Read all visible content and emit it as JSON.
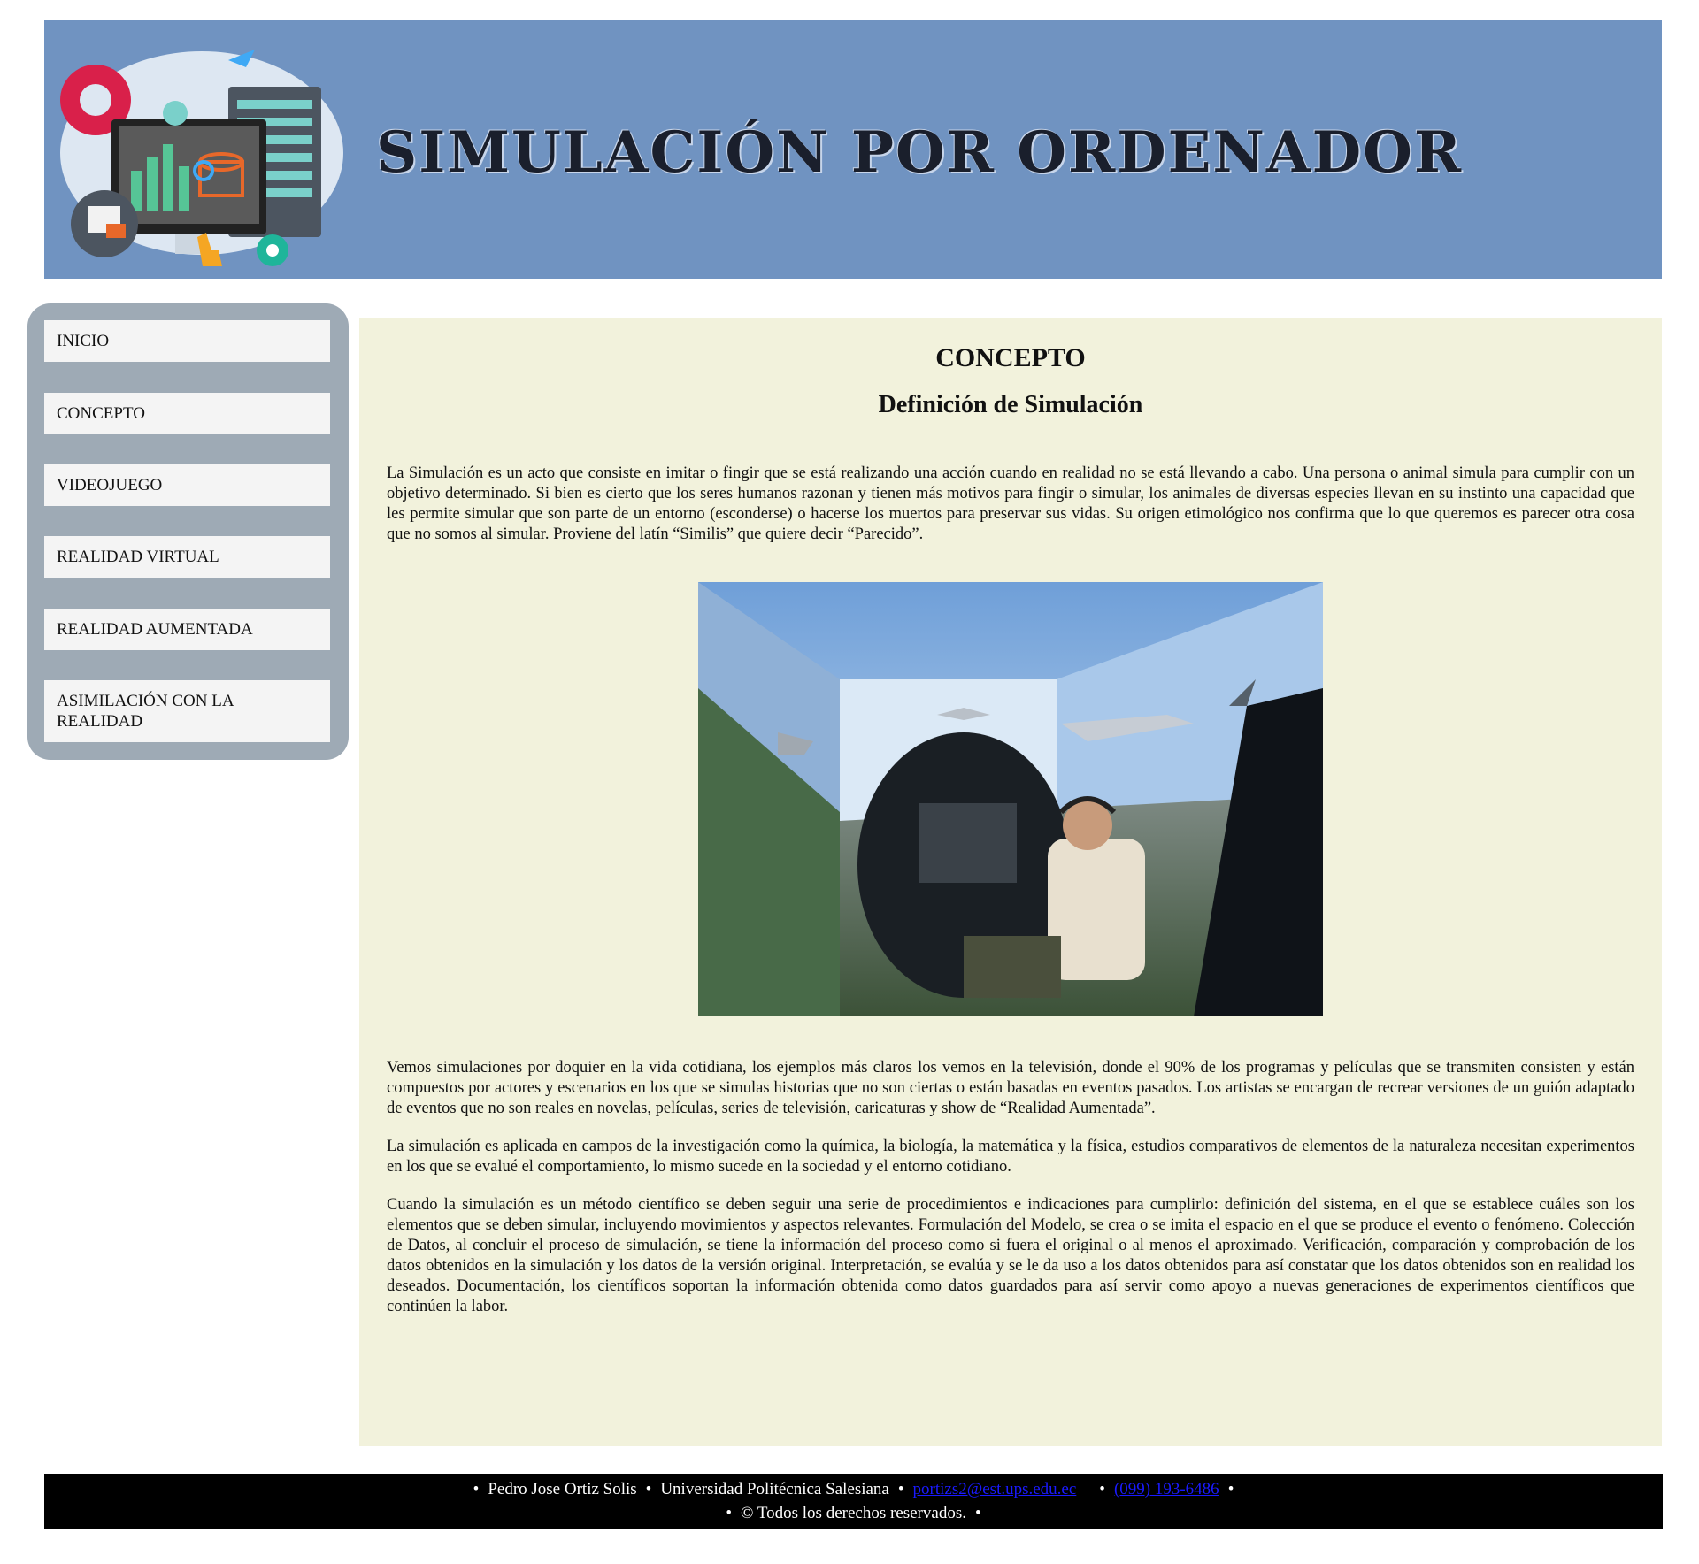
{
  "header": {
    "title": "SIMULACIÓN POR ORDENADOR",
    "logo": "computer-simulation-illustration"
  },
  "nav": {
    "items": [
      {
        "label": "INICIO"
      },
      {
        "label": "CONCEPTO"
      },
      {
        "label": "VIDEOJUEGO"
      },
      {
        "label": "REALIDAD VIRTUAL"
      },
      {
        "label": "REALIDAD AUMENTADA"
      },
      {
        "label": "ASIMILACIÓN CON LA REALIDAD"
      }
    ]
  },
  "main": {
    "heading": "CONCEPTO",
    "subheading": "Definición de Simulación",
    "paragraphs": [
      "La Simulación es un acto que consiste en imitar o fingir que se está realizando una acción cuando en realidad no se está llevando a cabo. Una persona o animal simula para cumplir con un objetivo determinado. Si bien es cierto que los seres humanos razonan y tienen más motivos para fingir o simular, los animales de diversas especies llevan en su instinto una capacidad que les permite simular que son parte de un entorno (esconderse) o hacerse los muertos para preservar sus vidas. Su origen etimológico nos confirma que lo que queremos es parecer otra cosa que no somos al simular. Proviene del latín “Similis” que quiere decir “Parecido”.",
      "Vemos simulaciones por doquier en la vida cotidiana, los ejemplos más claros los vemos en la televisión, donde el 90% de los programas y películas que se transmiten consisten y están compuestos por actores y escenarios en los que se simulas historias que no son ciertas o están basadas en eventos pasados. Los artistas se encargan de recrear versiones de un guión adaptado de eventos que no son reales en novelas, películas, series de televisión, caricaturas y show de “Realidad Aumentada”.",
      "La simulación es aplicada en campos de la investigación como la química, la biología, la matemática y la física, estudios comparativos de elementos de la naturaleza necesitan experimentos en los que se evalué el comportamiento, lo mismo sucede en la sociedad y el entorno cotidiano.",
      "Cuando la simulación es un método científico se deben seguir una serie de procedimientos e indicaciones para cumplirlo: definición del sistema, en el que se establece cuáles son los elementos que se deben simular, incluyendo movimientos y aspectos relevantes. Formulación del Modelo, se crea o se imita el espacio en el que se produce el evento o fenómeno. Colección de Datos, al concluir el proceso de simulación, se tiene la información del proceso como si fuera el original o al menos el aproximado. Verificación, comparación y comprobación de los datos obtenidos en la simulación y los datos de la versión original. Interpretación, se evalúa y se le da uso a los datos obtenidos para así constatar que los datos obtenidos son en realidad los deseados. Documentación, los científicos soportan la información obtenida como datos guardados para así servir como apoyo a nuevas generaciones de experimentos científicos que continúen la labor."
    ],
    "image": "flight-simulator-cockpit-photo"
  },
  "footer": {
    "bullet": "•",
    "author": "Pedro Jose Ortiz Solis",
    "university": "Universidad Politécnica Salesiana",
    "email": "portizs2@est.ups.edu.ec",
    "phone": "(099) 193-6486",
    "rights": "© Todos los derechos reservados."
  },
  "colors": {
    "header_bg": "#7093c1",
    "sidebar_bg": "#9eaab5",
    "content_bg": "#f2f2dc",
    "footer_bg": "#000000"
  }
}
